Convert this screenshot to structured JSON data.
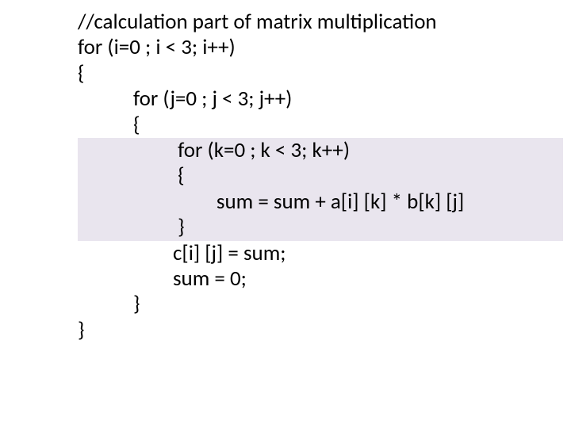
{
  "code": {
    "l1": "//calculation part of matrix multiplication",
    "l2": "for (i=0 ; i < 3; i++)",
    "l3": "{",
    "l4": "for (j=0 ; j < 3; j++)",
    "l5": "{",
    "l6": " for (k=0 ; k < 3; k++)",
    "l7": " {",
    "l8": "         sum = sum + a[i] [k] * b[k] [j]",
    "l9": " }",
    "l10": "c[i] [j] = sum;",
    "l11": "sum = 0;",
    "l12": "}",
    "l13": "}"
  }
}
